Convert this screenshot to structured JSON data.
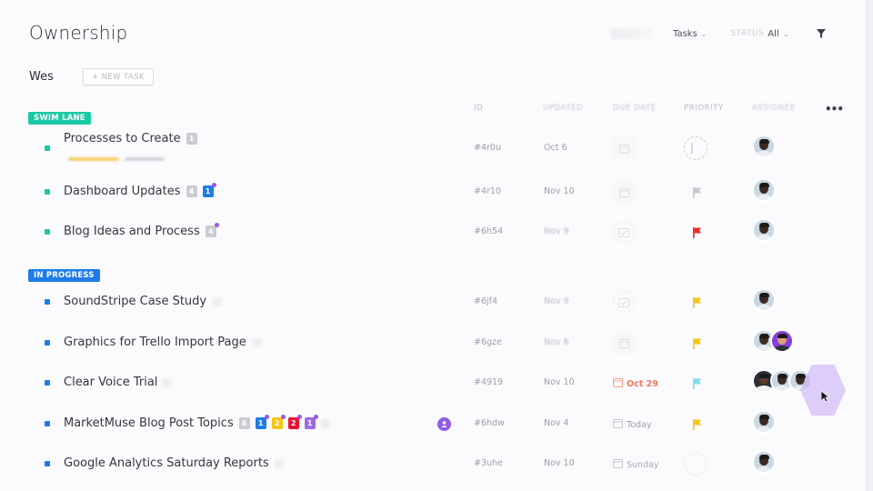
{
  "header": {
    "title": "Ownership",
    "tasks_dropdown": "Tasks",
    "status_label": "STATUS",
    "status_value": "All",
    "icons": {
      "filter": "filter-icon",
      "chevron": "chevron-down-icon",
      "more": "more-horizontal-icon"
    }
  },
  "group": {
    "name": "Wes",
    "new_task_label": "+ NEW TASK"
  },
  "columns": [
    "ID",
    "UPDATED",
    "DUE DATE",
    "PRIORITY",
    "ASSIGNEE"
  ],
  "more_label": "•••",
  "lanes": [
    {
      "label": "SWIM LANE",
      "color": "#1bc9a3",
      "tasks": [
        {
          "name": "Processes to Create",
          "badges": [
            {
              "text": "1",
              "color": "#c9ccd1",
              "pip": false
            }
          ],
          "id": "#4r0u",
          "updated": "Oct 6",
          "due": "",
          "due_icon": "calendar-empty",
          "priority": "none",
          "priority_color": "",
          "assignees": 1
        },
        {
          "name": "Dashboard Updates",
          "badges": [
            {
              "text": "4",
              "color": "#c9ccd1",
              "pip": false
            },
            {
              "text": "1",
              "color": "#1e7ce8",
              "pip": true
            }
          ],
          "id": "#4r10",
          "updated": "Nov 10",
          "due": "",
          "due_icon": "calendar-empty",
          "priority": "low",
          "priority_color": "#c6c9ce",
          "assignees": 1
        },
        {
          "name": "Blog Ideas and Process",
          "badges": [
            {
              "text": "4",
              "color": "#c9ccd1",
              "pip": true
            }
          ],
          "id": "#6h54",
          "updated": "Nov 9",
          "due": "",
          "due_icon": "calendar-check",
          "priority": "urgent",
          "priority_color": "#ef2b2b",
          "assignees": 1
        }
      ]
    },
    {
      "label": "IN PROGRESS",
      "color": "#1e7ce8",
      "tasks": [
        {
          "name": "SoundStripe Case Study",
          "badges": [],
          "id": "#6jf4",
          "updated": "Nov 9",
          "due": "",
          "due_icon": "calendar-check",
          "priority": "high",
          "priority_color": "#f7c515",
          "assignees": 1
        },
        {
          "name": "Graphics for Trello Import Page",
          "badges": [],
          "id": "#6gze",
          "updated": "Nov 6",
          "due": "",
          "due_icon": "calendar-empty",
          "priority": "high",
          "priority_color": "#f7c515",
          "assignees": 2
        },
        {
          "name": "Clear Voice Trial",
          "badges": [],
          "id": "#4919",
          "updated": "Nov 10",
          "due": "Oct 29",
          "due_color": "#f0785a",
          "due_icon": "calendar",
          "priority": "normal",
          "priority_color": "#7fdcea",
          "assignees": 3
        },
        {
          "name": "MarketMuse Blog Post Topics",
          "badges": [
            {
              "text": "6",
              "color": "#c9ccd1",
              "pip": false
            },
            {
              "text": "1",
              "color": "#1e7ce8",
              "pip": true
            },
            {
              "text": "2",
              "color": "#f7c515",
              "pip": true
            },
            {
              "text": "2",
              "color": "#e8112d",
              "pip": true
            },
            {
              "text": "1",
              "color": "#9b6be6",
              "pip": true
            }
          ],
          "id": "#6hdw",
          "updated": "Nov 4",
          "due": "Today",
          "due_color": "#9a9fa7",
          "due_icon": "calendar",
          "priority": "high",
          "priority_color": "#f7c515",
          "assignees": 1,
          "chat_icon": true
        },
        {
          "name": "Google Analytics Saturday Reports",
          "badges": [],
          "id": "#3uhe",
          "updated": "Nov 10",
          "due": "Sunday",
          "due_color": "#a9adb4",
          "due_icon": "calendar",
          "priority": "none-faded",
          "priority_color": "",
          "assignees": 1
        }
      ]
    }
  ]
}
